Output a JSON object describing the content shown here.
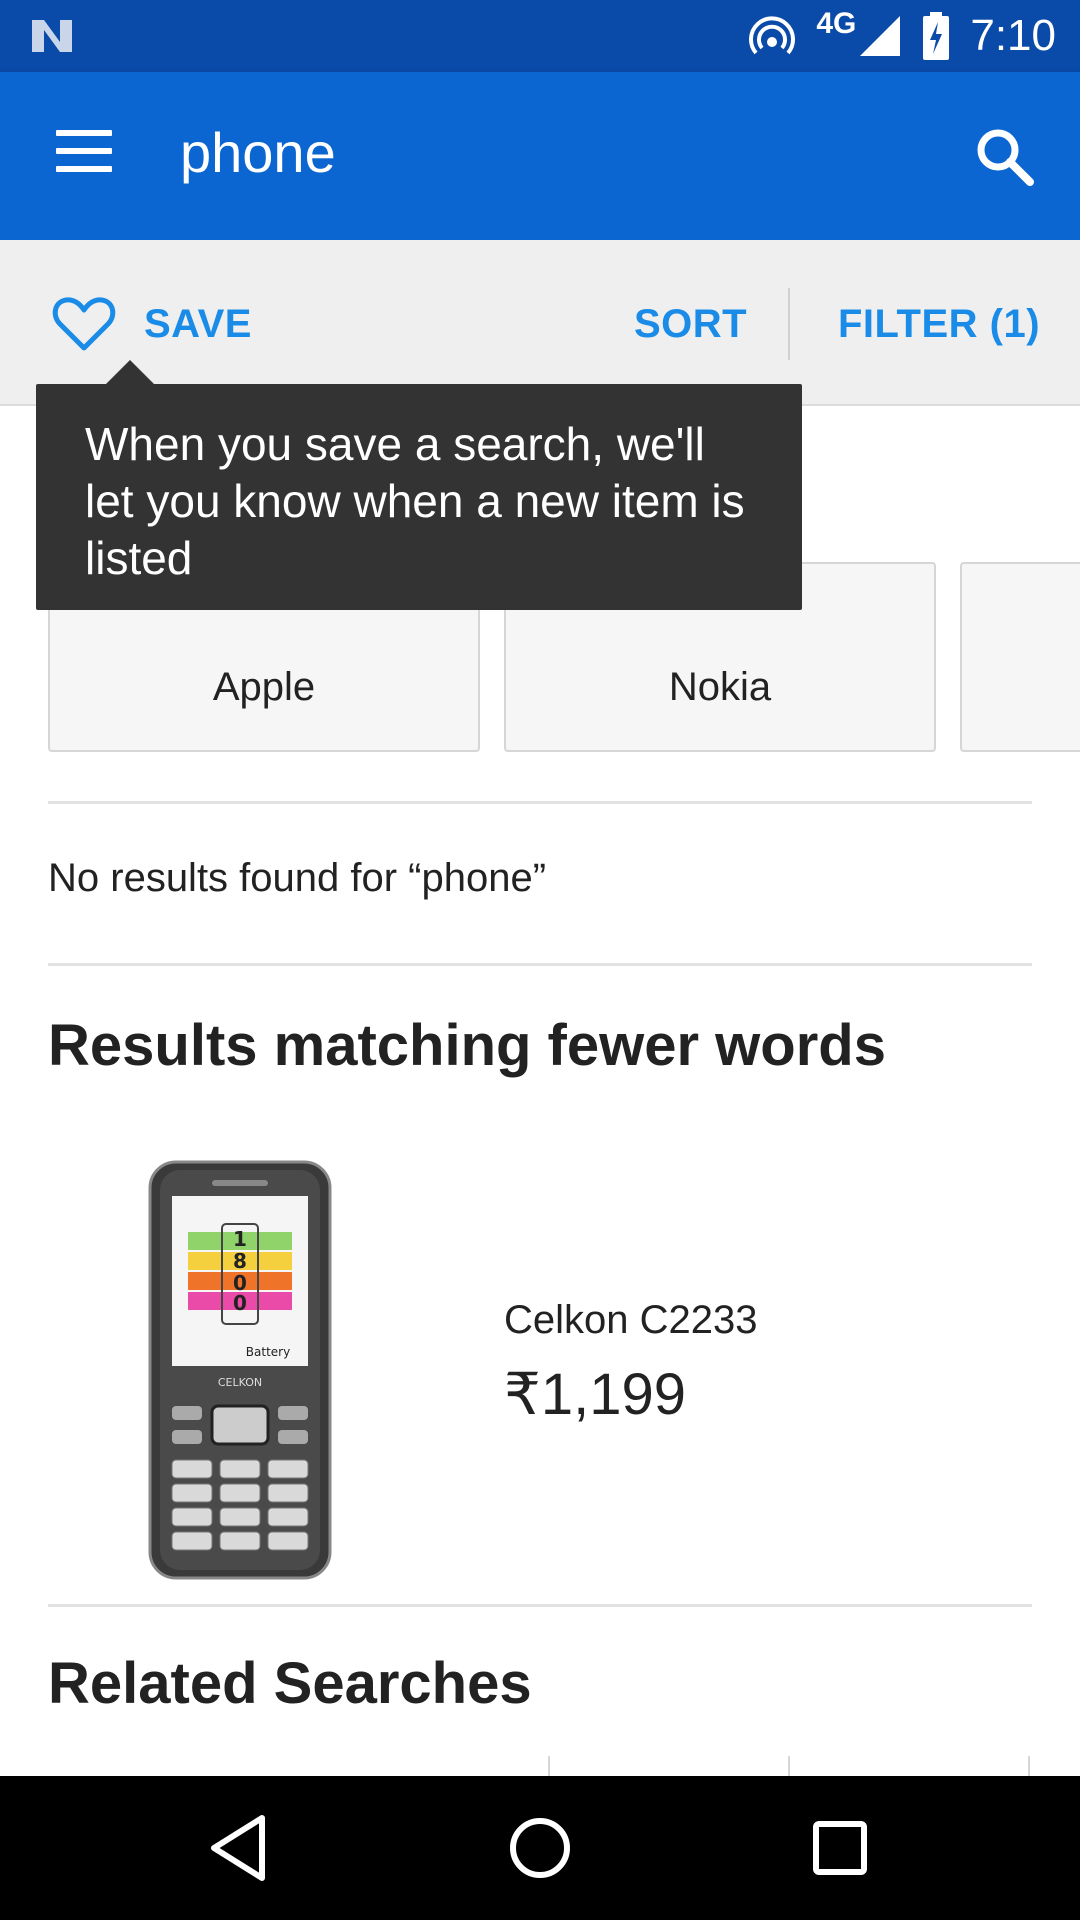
{
  "status_bar": {
    "network": "4G",
    "time": "7:10",
    "icons": [
      "n-logo-icon",
      "hotspot-icon",
      "signal-icon",
      "battery-charging-icon"
    ]
  },
  "app_bar": {
    "title": "phone",
    "icons": [
      "menu-icon",
      "search-icon"
    ]
  },
  "actions": {
    "save_label": "SAVE",
    "sort_label": "SORT",
    "filter_label": "FILTER (1)"
  },
  "tooltip": {
    "text": "When you save a search, we'll let you know when a new item is listed"
  },
  "brands": [
    {
      "label": "Apple"
    },
    {
      "label": "Nokia"
    },
    {
      "label": ""
    }
  ],
  "results": {
    "no_results_text": "No results found for “phone”",
    "fewer_words_title": "Results matching fewer words",
    "items": [
      {
        "name": "Celkon C2233",
        "price": "₹1,199"
      }
    ]
  },
  "related": {
    "title": "Related Searches"
  },
  "nav_bar": {
    "icons": [
      "back-icon",
      "home-icon",
      "recents-icon"
    ]
  }
}
